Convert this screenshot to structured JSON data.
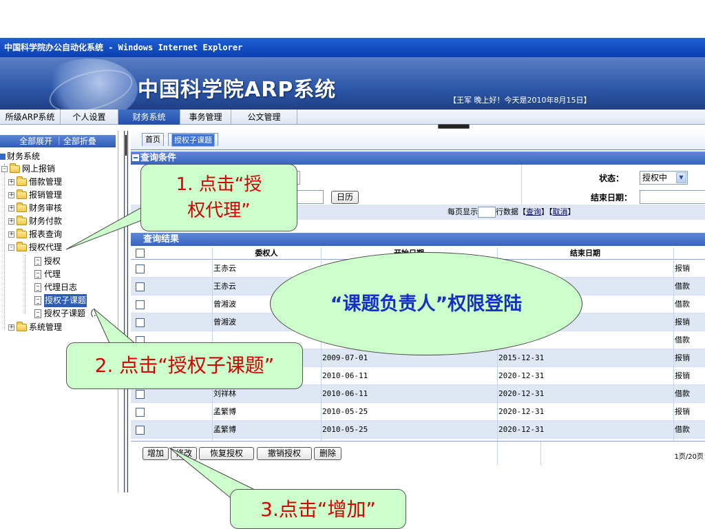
{
  "window": {
    "title": "中国科学院办公自动化系统 - Windows Internet Explorer"
  },
  "banner": {
    "title": "中国科学院ARP系统",
    "greeting": "【王军 晚上好！今天是2010年8月15日】"
  },
  "topnav": {
    "items": [
      {
        "label": "所级ARP系统"
      },
      {
        "label": "个人设置"
      },
      {
        "label": "财务系统"
      },
      {
        "label": "事务管理"
      },
      {
        "label": "公文管理"
      }
    ]
  },
  "sidebar": {
    "expand_label": "全部展开 ｜全部折叠",
    "root": "财务系统",
    "group": "网上报销",
    "items": [
      "借款管理",
      "报销管理",
      "财务审核",
      "财务付款",
      "报表查询",
      "授权代理"
    ],
    "sub_items": [
      "授权",
      "代理",
      "代理日志",
      "授权子课题",
      "授权子课题（..."
    ],
    "last": "系统管理"
  },
  "tabs": [
    {
      "label": "首页"
    },
    {
      "label": "授权子课题"
    }
  ],
  "query": {
    "header": "查询条件",
    "calendar_button": "日历",
    "status_label": "状态：",
    "status_value": "授权中",
    "end_date_label": "结束日期："
  },
  "pager": {
    "per_page_prefix": "每页显示",
    "per_page_suffix": "行数据",
    "query_link": "查询",
    "cancel_link": "取消"
  },
  "results": {
    "header": "查询结果",
    "columns": [
      "委权人",
      "开始日期",
      "结束日期"
    ],
    "rows": [
      {
        "name": "王赤云",
        "start": "",
        "end": "",
        "type": "报销"
      },
      {
        "name": "王赤云",
        "start": "",
        "end": "",
        "type": "借款"
      },
      {
        "name": "曾湘波",
        "start": "",
        "end": "",
        "type": "借款"
      },
      {
        "name": "曾湘波",
        "start": "",
        "end": "",
        "type": "报销"
      },
      {
        "name": "",
        "start": "",
        "end": "-12-31",
        "type": "借款"
      },
      {
        "name": "",
        "start": "2009-07-01",
        "end": "2015-12-31",
        "type": "报销"
      },
      {
        "name": "",
        "start": "2010-06-11",
        "end": "2020-12-31",
        "type": "报销"
      },
      {
        "name": "刘祥林",
        "start": "2010-06-11",
        "end": "2020-12-31",
        "type": "借款"
      },
      {
        "name": "孟繁博",
        "start": "2010-05-25",
        "end": "2020-12-31",
        "type": "报销"
      },
      {
        "name": "孟繁博",
        "start": "2010-05-25",
        "end": "2020-12-31",
        "type": "借款"
      }
    ]
  },
  "actions": {
    "add": "增加",
    "edit": "修改",
    "restore": "恢复授权",
    "revoke": "撤销授权",
    "delete": "删除"
  },
  "page_info": "1页/20页",
  "annotations": {
    "step1": [
      "1. 点击“授",
      "权代理”"
    ],
    "step2": "2. 点击“授权子课题”",
    "step3": "3.点击“增加”",
    "role": "“课题负责人”权限登陆"
  },
  "colors": {
    "callout_fill": "#ccffcc",
    "callout_text": "#d40000",
    "role_text": "#1530c2",
    "header_blue": "#3664bc"
  }
}
